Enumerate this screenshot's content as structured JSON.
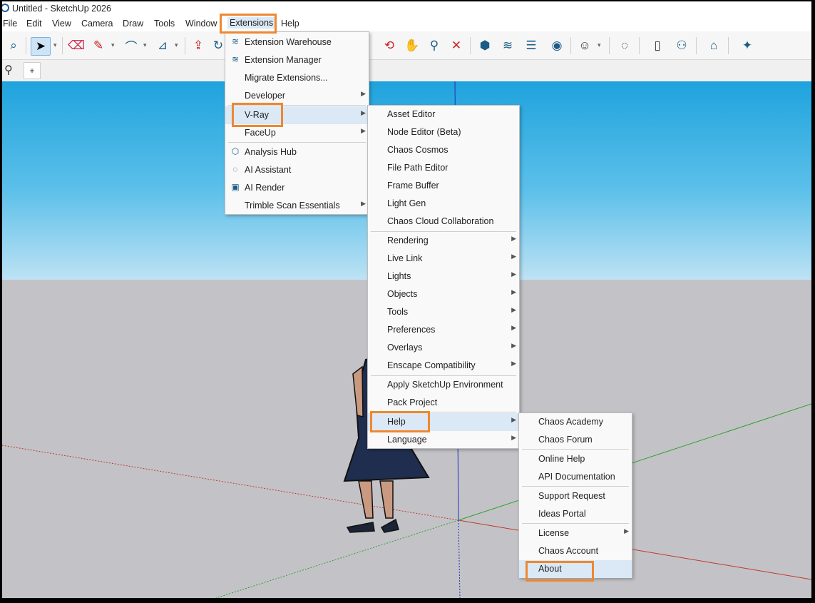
{
  "window": {
    "title": "Untitled - SketchUp 2026"
  },
  "menubar": [
    "File",
    "Edit",
    "View",
    "Camera",
    "Draw",
    "Tools",
    "Window",
    "Extensions",
    "Help"
  ],
  "accent_color": "#EE8830",
  "extensions_menu": [
    {
      "label": "Extension Warehouse",
      "icon": "extension-warehouse-icon"
    },
    {
      "label": "Extension Manager",
      "icon": "extension-manager-icon"
    },
    {
      "label": "Migrate Extensions..."
    },
    {
      "label": "Developer",
      "submenu": true
    },
    {
      "label": "V-Ray",
      "submenu": true,
      "highlighted": true
    },
    {
      "label": "FaceUp",
      "submenu": true
    },
    {
      "label": "Analysis Hub",
      "icon": "analysis-hub-icon"
    },
    {
      "label": "AI Assistant",
      "icon": "ai-assistant-icon"
    },
    {
      "label": "AI Render",
      "icon": "ai-render-icon"
    },
    {
      "label": "Trimble Scan Essentials",
      "submenu": true
    }
  ],
  "vray_menu": [
    {
      "label": "Asset Editor"
    },
    {
      "label": "Node Editor (Beta)"
    },
    {
      "label": "Chaos Cosmos"
    },
    {
      "label": "File Path Editor"
    },
    {
      "label": "Frame Buffer"
    },
    {
      "label": "Light Gen"
    },
    {
      "label": "Chaos Cloud Collaboration"
    },
    {
      "label": "Rendering",
      "submenu": true
    },
    {
      "label": "Live Link",
      "submenu": true
    },
    {
      "label": "Lights",
      "submenu": true
    },
    {
      "label": "Objects",
      "submenu": true
    },
    {
      "label": "Tools",
      "submenu": true
    },
    {
      "label": "Preferences",
      "submenu": true
    },
    {
      "label": "Overlays",
      "submenu": true
    },
    {
      "label": "Enscape Compatibility",
      "submenu": true
    },
    {
      "label": "Apply SketchUp Environment"
    },
    {
      "label": "Pack Project"
    },
    {
      "label": "Help",
      "submenu": true,
      "highlighted": true
    },
    {
      "label": "Language",
      "submenu": true
    }
  ],
  "help_menu": [
    {
      "label": "Chaos Academy"
    },
    {
      "label": "Chaos Forum"
    },
    {
      "label": "Online Help"
    },
    {
      "label": "API Documentation"
    },
    {
      "label": "Support Request"
    },
    {
      "label": "Ideas Portal"
    },
    {
      "label": "License",
      "submenu": true
    },
    {
      "label": "Chaos Account"
    },
    {
      "label": "About",
      "highlighted": true
    }
  ],
  "toolbar2": {
    "add_label": "+"
  },
  "icons": {
    "submenu_arrow": "▶"
  }
}
